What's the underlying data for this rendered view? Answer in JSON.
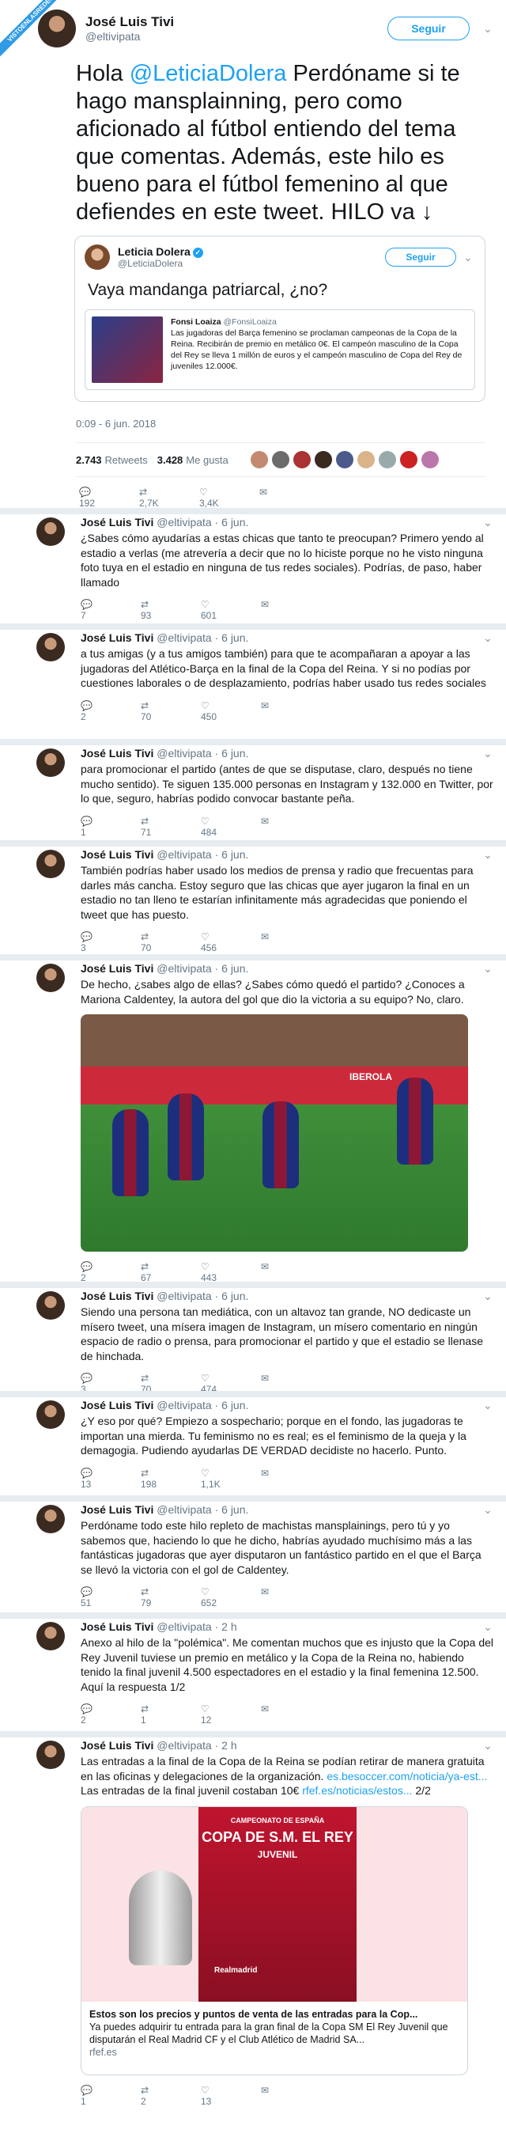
{
  "watermark": "VISTOENLASREDES",
  "main": {
    "name": "José Luis Tivi",
    "handle": "@eltivipata",
    "follow": "Seguir",
    "text_before": "Hola ",
    "mention": "@LeticiaDolera",
    "text_after": " Perdóname si te hago mansplainning, pero como aficionado al fútbol entiendo del tema que comentas. Además, este hilo es bueno para el fútbol femenino al que defiendes en este tweet. HILO va ↓",
    "quote": {
      "name": "Leticia Dolera",
      "handle": "@LeticiaDolera",
      "follow": "Seguir",
      "text": "Vaya mandanga patriarcal, ¿no?",
      "inner_name": "Fonsi Loaiza",
      "inner_handle": "@FonsiLoaiza",
      "inner_text": "Las jugadoras del Barça femenino se proclaman campeonas de la Copa de la Reina. Recibirán de premio en metálico 0€. El campeón masculino de la Copa del Rey se lleva 1 millón de euros y el campeón masculino de Copa del Rey de juveniles 12.000€."
    },
    "date": "0:09 - 6 jun. 2018",
    "retweets": "2.743",
    "retweets_label": "Retweets",
    "likes": "3.428",
    "likes_label": "Me gusta",
    "replies": "192",
    "rt": "2,7K",
    "lk": "3,4K"
  },
  "tweets": [
    {
      "name": "José Luis Tivi",
      "handle": "@eltivipata · 6 jun.",
      "text": "¿Sabes cómo ayudarías a estas chicas que tanto te preocupan? Primero yendo al estadio a verlas (me atrevería a decir que no lo hiciste porque no he visto ninguna foto tuya en el estadio en ninguna de tus redes sociales). Podrías, de paso, haber llamado",
      "r": "7",
      "rt": "93",
      "l": "601"
    },
    {
      "name": "José Luis Tivi",
      "handle": "@eltivipata · 6 jun.",
      "text": "a tus amigas (y a tus amigos también) para que te acompañaran a apoyar a las jugadoras del Atlético-Barça en la final de la Copa del Reina. Y si no podías por cuestiones laborales o de desplazamiento, podrías haber usado tus redes sociales",
      "r": "2",
      "rt": "70",
      "l": "450"
    },
    {
      "name": "José Luis Tivi",
      "handle": "@eltivipata · 6 jun.",
      "text": "para promocionar el partido (antes de que se disputase, claro, después no tiene mucho sentido). Te siguen 135.000 personas en Instagram y 132.000 en Twitter, por lo que, seguro, habrías podido convocar bastante peña.",
      "r": "1",
      "rt": "71",
      "l": "484"
    },
    {
      "name": "José Luis Tivi",
      "handle": "@eltivipata · 6 jun.",
      "text": "También podrías haber usado los medios de prensa y radio que frecuentas para darles más cancha. Estoy seguro que las chicas que ayer jugaron la final en un estadio no tan lleno te estarían infinitamente más agradecidas que poniendo el tweet que has puesto.",
      "r": "3",
      "rt": "70",
      "l": "456"
    },
    {
      "name": "José Luis Tivi",
      "handle": "@eltivipata · 6 jun.",
      "text": "De hecho, ¿sabes algo de ellas? ¿Sabes cómo quedó el partido? ¿Conoces a Mariona Caldentey, la autora del gol que dio la victoria a su equipo? No, claro.",
      "r": "2",
      "rt": "67",
      "l": "443",
      "photo_text": "IBEROLA"
    },
    {
      "name": "José Luis Tivi",
      "handle": "@eltivipata · 6 jun.",
      "text": "Siendo una persona tan mediática, con un altavoz tan grande, NO dedicaste un mísero tweet, una mísera imagen de Instagram, un mísero comentario en ningún espacio de radio o prensa, para promocionar el partido y que el estadio se llenase de hinchada.",
      "r": "3",
      "rt": "70",
      "l": "474"
    },
    {
      "name": "José Luis Tivi",
      "handle": "@eltivipata · 6 jun.",
      "text": "¿Y eso por qué? Empiezo a sospechario; porque en el fondo, las jugadoras te importan una mierda. Tu feminismo no es real; es el feminismo de la queja y la demagogia. Pudiendo ayudarlas DE VERDAD decidiste no hacerlo. Punto.",
      "r": "13",
      "rt": "198",
      "l": "1,1K"
    },
    {
      "name": "José Luis Tivi",
      "handle": "@eltivipata · 6 jun.",
      "text": "Perdóname todo este hilo repleto de machistas mansplainings, pero tú y yo sabemos que, haciendo lo que he dicho, habrías ayudado muchísimo más a las fantásticas jugadoras que ayer disputaron un fantástico partido en el que el Barça se llevó la victoria con el gol de Caldentey.",
      "r": "51",
      "rt": "79",
      "l": "652"
    },
    {
      "name": "José Luis Tivi",
      "handle": "@eltivipata · 2 h",
      "text": "Anexo al hilo de la \"polémica\". Me comentan muchos que es injusto que la Copa del Rey Juvenil tuviese un premio en metálico y la Copa de la Reina no, habiendo tenido la final juvenil 4.500 espectadores en el estadio y la final femenina 12.500. Aquí la respuesta 1/2",
      "r": "2",
      "rt": "1",
      "l": "12"
    },
    {
      "name": "José Luis Tivi",
      "handle": "@eltivipata · 2 h",
      "text": "Las entradas a la final de la Copa de la Reina se podían retirar de manera gratuita en las oficinas y delegaciones de la organización.",
      "link1": "es.besoccer.com/noticia/ya-est...",
      "text2": " Las entradas de la final juvenil costaban 10€",
      "link2": "rfef.es/noticias/estos...",
      "text3": " 2/2",
      "r": "1",
      "rt": "2",
      "l": "13",
      "card": {
        "poster_title": "CAMPEONATO DE ESPAÑA",
        "poster_big": "COPA DE S.M. EL REY",
        "poster_sub": "JUVENIL",
        "club1": "Realmadrid",
        "title": "Estos son los precios y puntos de venta de las entradas para la Cop...",
        "desc": "Ya puedes adquirir tu entrada para la gran final de la Copa SM El Rey Juvenil que disputarán el Real Madrid CF y el Club Atlético de Madrid SA...",
        "domain": "rfef.es"
      }
    }
  ],
  "colors": {
    "accent": "#1da1f2",
    "muted": "#657786",
    "border": "#e6ecf0"
  }
}
